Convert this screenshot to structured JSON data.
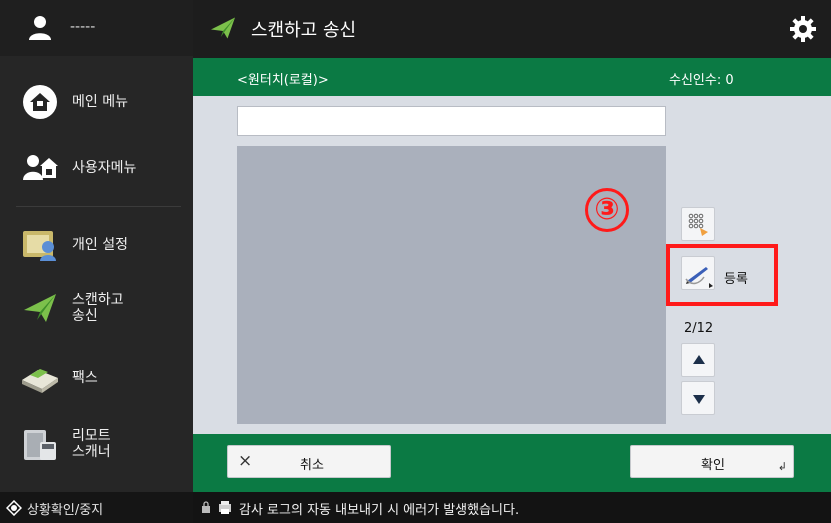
{
  "sidebar": {
    "user": {
      "name": "-----",
      "icon": "user-icon"
    },
    "items": [
      {
        "label": "메인 메뉴",
        "icon": "home-icon"
      },
      {
        "label": "사용자메뉴",
        "icon": "user-menu-icon"
      },
      {
        "label": "개인 설정",
        "icon": "personal-settings-icon"
      },
      {
        "label": "스캔하고\n송신",
        "icon": "scan-send-icon"
      },
      {
        "label": "팩스",
        "icon": "fax-icon"
      },
      {
        "label": "리모트\n스캐너",
        "icon": "remote-scanner-icon"
      }
    ],
    "status_button": {
      "label": "상황확인/중지",
      "icon": "status-check-icon"
    }
  },
  "header": {
    "title": "스캔하고 송신",
    "icon": "scan-send-icon",
    "settings_icon": "gear-icon"
  },
  "panel": {
    "location": "<원터치(로컬)>",
    "recipients": "수신인수: 0",
    "search_value": "",
    "step_marker": "③",
    "register_label": "등록",
    "page_indicator": "2/12"
  },
  "footer": {
    "cancel_icon": "×",
    "cancel_label": "취소",
    "ok_label": "확인",
    "ok_corner": "↲"
  },
  "status": {
    "message": "감사 로그의 자동 내보내기 시 에러가 발생했습니다."
  },
  "colors": {
    "green": "#0b7a44",
    "highlight": "#ff1a1a",
    "list_area": "#aab0bc",
    "panel_bg": "#d9dde4"
  }
}
